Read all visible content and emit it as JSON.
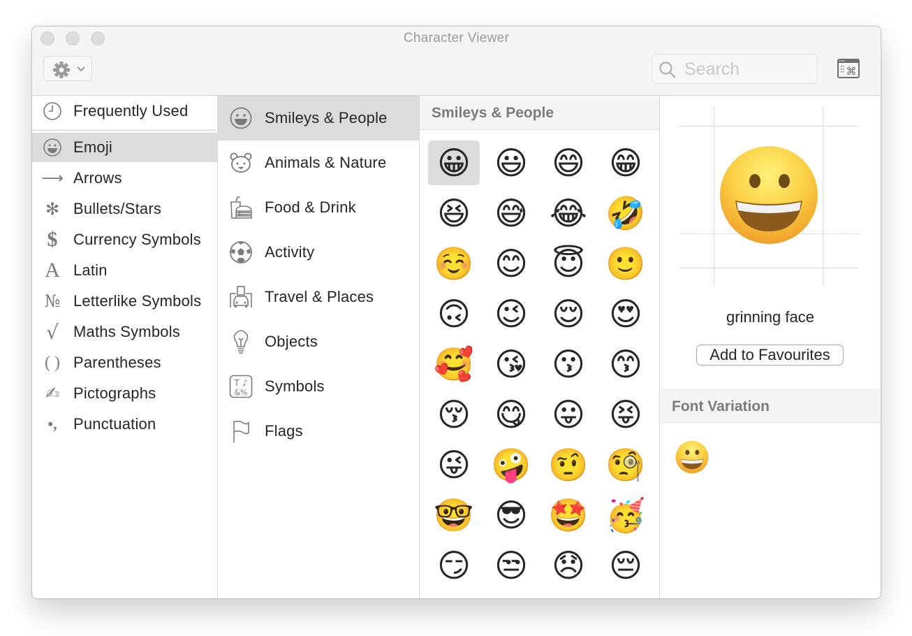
{
  "window": {
    "title": "Character Viewer",
    "traffic_lights": [
      "close",
      "minimize",
      "zoom"
    ]
  },
  "toolbar": {
    "action_menu_icon": "gear-icon",
    "search_placeholder": "Search",
    "search_value": "",
    "palette_button_icon": "character-palette-icon"
  },
  "categories": [
    {
      "label": "Frequently Used",
      "icon": "clock-icon",
      "glyph": ""
    },
    {
      "label": "Emoji",
      "icon": "smiley-icon",
      "glyph": "",
      "selected": true
    },
    {
      "label": "Arrows",
      "icon": "arrow-icon",
      "glyph": "⟶"
    },
    {
      "label": "Bullets/Stars",
      "icon": "asterisk-icon",
      "glyph": "✻"
    },
    {
      "label": "Currency Symbols",
      "icon": "dollar-icon",
      "glyph": "$"
    },
    {
      "label": "Latin",
      "icon": "letter-a-icon",
      "glyph": "A"
    },
    {
      "label": "Letterlike Symbols",
      "icon": "numero-icon",
      "glyph": "№"
    },
    {
      "label": "Maths Symbols",
      "icon": "square-root-icon",
      "glyph": "√"
    },
    {
      "label": "Parentheses",
      "icon": "parentheses-icon",
      "glyph": "( )"
    },
    {
      "label": "Pictographs",
      "icon": "writing-hand-icon",
      "glyph": "✍"
    },
    {
      "label": "Punctuation",
      "icon": "punctuation-icon",
      "glyph": "•,"
    }
  ],
  "subcategories": [
    {
      "label": "Smileys & People",
      "icon": "smiley-icon",
      "selected": true
    },
    {
      "label": "Animals & Nature",
      "icon": "bear-icon"
    },
    {
      "label": "Food & Drink",
      "icon": "burger-drink-icon"
    },
    {
      "label": "Activity",
      "icon": "football-icon"
    },
    {
      "label": "Travel & Places",
      "icon": "car-buildings-icon"
    },
    {
      "label": "Objects",
      "icon": "lightbulb-icon"
    },
    {
      "label": "Symbols",
      "icon": "symbols-icon"
    },
    {
      "label": "Flags",
      "icon": "flag-icon"
    }
  ],
  "emoji_section": {
    "title": "Smileys & People",
    "selected_index": 0,
    "emojis": [
      "😀",
      "😃",
      "😄",
      "😁",
      "😆",
      "😅",
      "😂",
      "🤣",
      "☺️",
      "😊",
      "😇",
      "🙂",
      "🙃",
      "😉",
      "😌",
      "😍",
      "🥰",
      "😘",
      "😗",
      "😙",
      "😚",
      "😋",
      "😛",
      "😝",
      "😜",
      "🤪",
      "🤨",
      "🧐",
      "🤓",
      "😎",
      "🤩",
      "🥳",
      "😏",
      "😒",
      "😞",
      "😔"
    ]
  },
  "detail": {
    "character": "😀",
    "name": "grinning face",
    "add_favourites_label": "Add to Favourites",
    "font_variation_title": "Font Variation",
    "font_variations": [
      "😀"
    ]
  }
}
